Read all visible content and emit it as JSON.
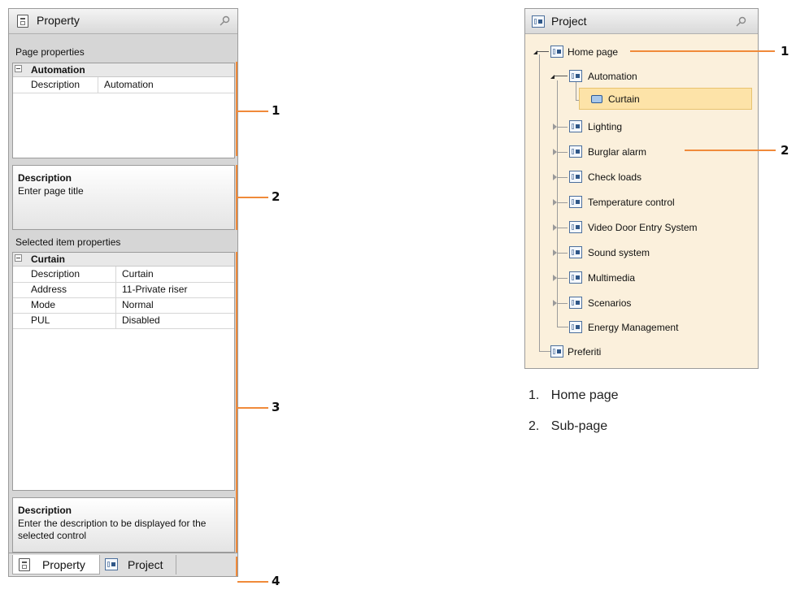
{
  "property_panel": {
    "title": "Property",
    "page_properties_label": "Page properties",
    "page_grid": {
      "header": "Automation",
      "rows": [
        {
          "key": "Description",
          "value": "Automation"
        }
      ]
    },
    "page_description": {
      "title": "Description",
      "text": "Enter page title"
    },
    "selected_item_label": "Selected item properties",
    "item_grid": {
      "header": "Curtain",
      "rows": [
        {
          "key": "Description",
          "value": "Curtain"
        },
        {
          "key": "Address",
          "value": "11-Private riser"
        },
        {
          "key": "Mode",
          "value": "Normal"
        },
        {
          "key": "PUL",
          "value": "Disabled"
        }
      ]
    },
    "item_description": {
      "title": "Description",
      "text": "Enter the description to be displayed for the selected control"
    },
    "tabs": [
      {
        "label": "Property"
      },
      {
        "label": "Project"
      }
    ]
  },
  "callouts_left": [
    "1",
    "2",
    "3",
    "4"
  ],
  "project_panel": {
    "title": "Project",
    "tree": {
      "root": "Home page",
      "automation": "Automation",
      "curtain": "Curtain",
      "children": [
        "Lighting",
        "Burglar alarm",
        "Check loads",
        "Temperature control",
        "Video Door Entry System",
        "Sound system",
        "Multimedia",
        "Scenarios",
        "Energy Management"
      ],
      "preferiti": "Preferiti"
    }
  },
  "callouts_right": [
    "1",
    "2"
  ],
  "legend": [
    {
      "num": "1.",
      "text": "Home page"
    },
    {
      "num": "2.",
      "text": "Sub-page"
    }
  ],
  "colors": {
    "accent": "#f08a3a",
    "tree_background": "#fbf0dc",
    "selection": "#fde3a8"
  }
}
